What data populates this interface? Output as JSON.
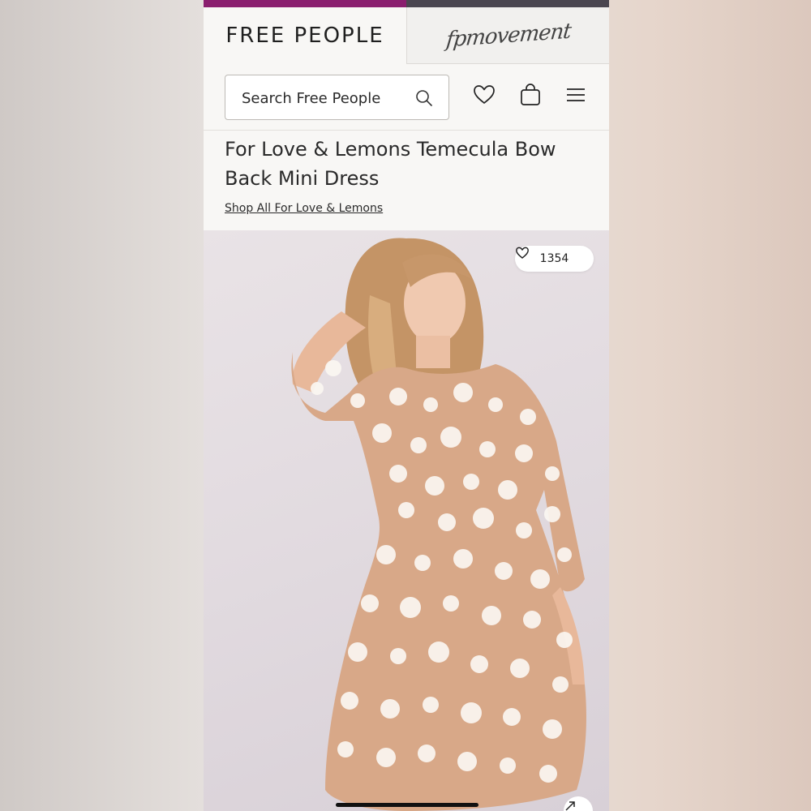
{
  "header": {
    "brand_tab": "FREE PEOPLE",
    "movement_tab": "fpmovement",
    "accent_color": "#8a1e6e"
  },
  "search": {
    "placeholder": "Search Free People"
  },
  "icons": {
    "search": "search-icon",
    "wishlist": "heart-icon",
    "bag": "shopping-bag-icon",
    "menu": "hamburger-menu-icon",
    "expand": "expand-icon"
  },
  "product": {
    "title": "For Love & Lemons Temecula Bow Back Mini Dress",
    "brand_link": "Shop All For Love & Lemons",
    "likes_count": "1354"
  }
}
